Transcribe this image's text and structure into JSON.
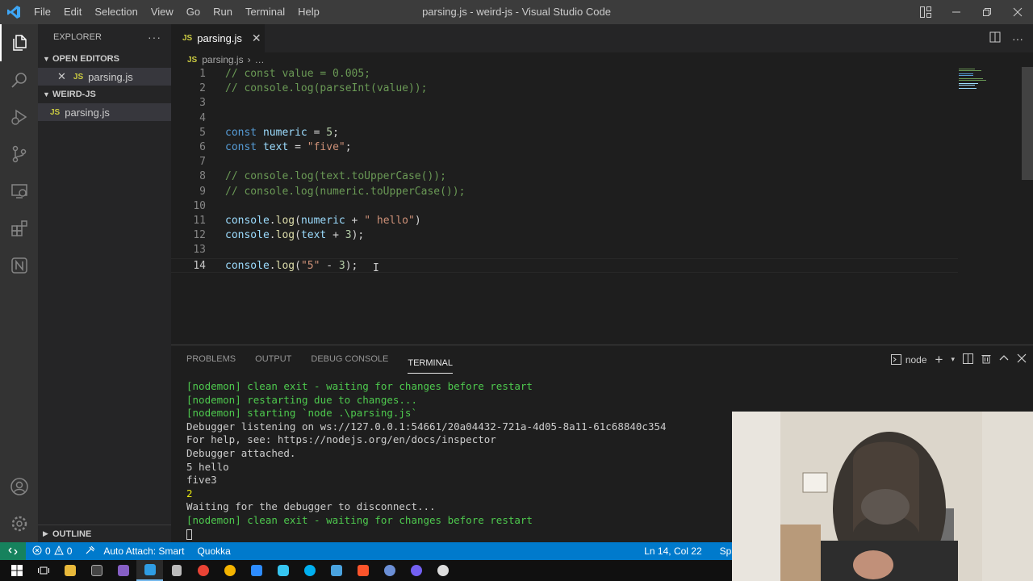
{
  "window": {
    "title": "parsing.js - weird-js - Visual Studio Code",
    "menu": [
      "File",
      "Edit",
      "Selection",
      "View",
      "Go",
      "Run",
      "Terminal",
      "Help"
    ]
  },
  "sidebar": {
    "header": "EXPLORER",
    "open_editors_label": "OPEN EDITORS",
    "open_editor_file": "parsing.js",
    "folder_label": "WEIRD-JS",
    "folder_file": "parsing.js",
    "outline_label": "OUTLINE",
    "js_badge": "JS"
  },
  "tabs": [
    {
      "label": "parsing.js",
      "badge": "JS"
    }
  ],
  "breadcrumb": {
    "file": "parsing.js",
    "rest": "…"
  },
  "editor": {
    "current_line": 14,
    "lines": [
      {
        "n": "1",
        "tokens": [
          [
            "com",
            "// const value = 0.005;"
          ]
        ]
      },
      {
        "n": "2",
        "tokens": [
          [
            "com",
            "// console.log(parseInt(value));"
          ]
        ]
      },
      {
        "n": "3",
        "tokens": []
      },
      {
        "n": "4",
        "tokens": []
      },
      {
        "n": "5",
        "tokens": [
          [
            "kw",
            "const"
          ],
          [
            "pl",
            " "
          ],
          [
            "var",
            "numeric"
          ],
          [
            "pl",
            " = "
          ],
          [
            "num",
            "5"
          ],
          [
            "pl",
            ";"
          ]
        ]
      },
      {
        "n": "6",
        "tokens": [
          [
            "kw",
            "const"
          ],
          [
            "pl",
            " "
          ],
          [
            "var",
            "text"
          ],
          [
            "pl",
            " = "
          ],
          [
            "str",
            "\"five\""
          ],
          [
            "pl",
            ";"
          ]
        ]
      },
      {
        "n": "7",
        "tokens": []
      },
      {
        "n": "8",
        "tokens": [
          [
            "com",
            "// console.log(text.toUpperCase());"
          ]
        ]
      },
      {
        "n": "9",
        "tokens": [
          [
            "com",
            "// console.log(numeric.toUpperCase());"
          ]
        ]
      },
      {
        "n": "10",
        "tokens": []
      },
      {
        "n": "11",
        "tokens": [
          [
            "var",
            "console"
          ],
          [
            "pl",
            "."
          ],
          [
            "fn",
            "log"
          ],
          [
            "pl",
            "("
          ],
          [
            "var",
            "numeric"
          ],
          [
            "pl",
            " + "
          ],
          [
            "str",
            "\" hello\""
          ],
          [
            "pl",
            ")"
          ]
        ]
      },
      {
        "n": "12",
        "tokens": [
          [
            "var",
            "console"
          ],
          [
            "pl",
            "."
          ],
          [
            "fn",
            "log"
          ],
          [
            "pl",
            "("
          ],
          [
            "var",
            "text"
          ],
          [
            "pl",
            " + "
          ],
          [
            "num",
            "3"
          ],
          [
            "pl",
            ");"
          ]
        ]
      },
      {
        "n": "13",
        "tokens": []
      },
      {
        "n": "14",
        "tokens": [
          [
            "var",
            "console"
          ],
          [
            "pl",
            "."
          ],
          [
            "fn",
            "log"
          ],
          [
            "pl",
            "("
          ],
          [
            "str",
            "\"5\""
          ],
          [
            "pl",
            " - "
          ],
          [
            "num",
            "3"
          ],
          [
            "pl",
            ");"
          ]
        ]
      }
    ]
  },
  "panel": {
    "tabs": [
      "PROBLEMS",
      "OUTPUT",
      "DEBUG CONSOLE",
      "TERMINAL"
    ],
    "active_tab": "TERMINAL",
    "terminal_name": "node",
    "terminal_lines": [
      {
        "text": "[nodemon] clean exit - waiting for changes before restart",
        "color": "green"
      },
      {
        "text": "[nodemon] restarting due to changes...",
        "color": "green"
      },
      {
        "text": "[nodemon] starting `node .\\parsing.js`",
        "color": "green"
      },
      {
        "text": "Debugger listening on ws://127.0.0.1:54661/20a04432-721a-4d05-8a11-61c68840c354",
        "color": "default"
      },
      {
        "text": "For help, see: https://nodejs.org/en/docs/inspector",
        "color": "default"
      },
      {
        "text": "Debugger attached.",
        "color": "default"
      },
      {
        "text": "5 hello",
        "color": "default"
      },
      {
        "text": "five3",
        "color": "default"
      },
      {
        "text": "2",
        "color": "yellow"
      },
      {
        "text": "Waiting for the debugger to disconnect...",
        "color": "default"
      },
      {
        "text": "[nodemon] clean exit - waiting for changes before restart",
        "color": "green"
      }
    ]
  },
  "statusbar": {
    "errors": "0",
    "warnings": "0",
    "auto_attach": "Auto Attach: Smart",
    "quokka": "Quokka",
    "cursor_pos": "Ln 14, Col 22",
    "spaces": "Spa"
  },
  "colors": {
    "activity_bar": "#333333",
    "sidebar": "#252526",
    "editor_bg": "#1e1e1e",
    "statusbar": "#007acc",
    "title_bar": "#3c3c3c",
    "terminal_green": "#4ec94e",
    "terminal_yellow": "#e5e510"
  },
  "taskbar_icons": [
    "windows-start-icon",
    "task-view-icon",
    "file-explorer-icon",
    "terminal-icon",
    "visual-studio-icon",
    "vscode-icon",
    "library-icon",
    "chrome-icon",
    "chrome-alt-icon",
    "zoom-icon",
    "slack-icon",
    "skype-icon",
    "pen-tool-icon",
    "brave-icon",
    "globe-icon",
    "viber-icon",
    "github-icon"
  ]
}
